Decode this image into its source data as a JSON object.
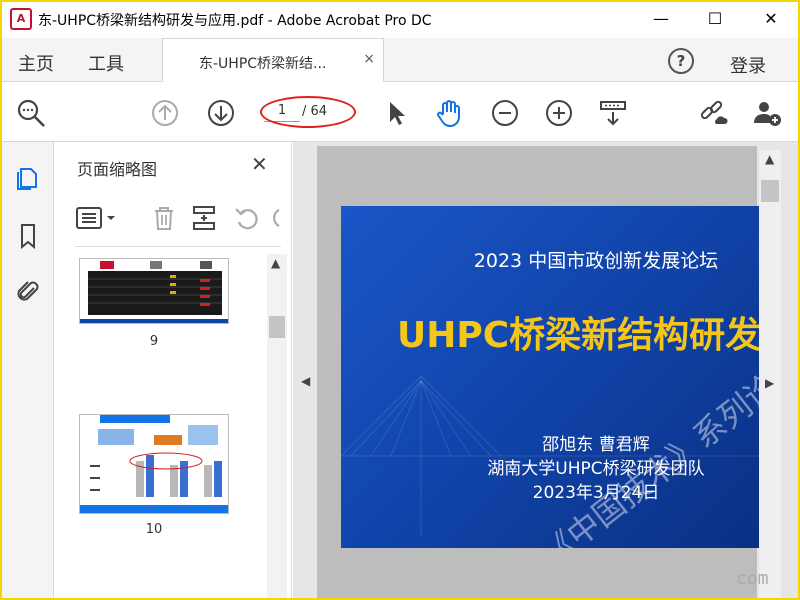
{
  "window": {
    "title": "东-UHPC桥梁新结构研发与应用.pdf - Adobe Acrobat Pro DC",
    "app_logo_text": "A",
    "minimize": "—",
    "maximize": "☐",
    "close": "✕"
  },
  "tabs": {
    "home": "主页",
    "tools": "工具",
    "document_tab_label": "东-UHPC桥梁新结...",
    "document_tab_close": "×",
    "help": "?",
    "login": "登录"
  },
  "toolbar": {
    "current_page": "1",
    "total_pages": "/ 64"
  },
  "thumbnails_panel": {
    "title": "页面缩略图",
    "close": "✕",
    "pages": [
      {
        "number": "9"
      },
      {
        "number": "10"
      }
    ]
  },
  "document": {
    "conference": "2023 中国市政创新发展论坛",
    "title": "UHPC桥梁新结构研发与",
    "authors": "邵旭东 曹君辉",
    "team": "湖南大学UHPC桥梁研发团队",
    "date": "2023年3月24日",
    "watermark": "《中国技术》系列论坛"
  },
  "corner_watermark": "com",
  "colors": {
    "slide_blue": "#1043a8",
    "slide_title": "#f5c518",
    "annotation_red": "#e02020",
    "accent_blue": "#1473e6"
  }
}
